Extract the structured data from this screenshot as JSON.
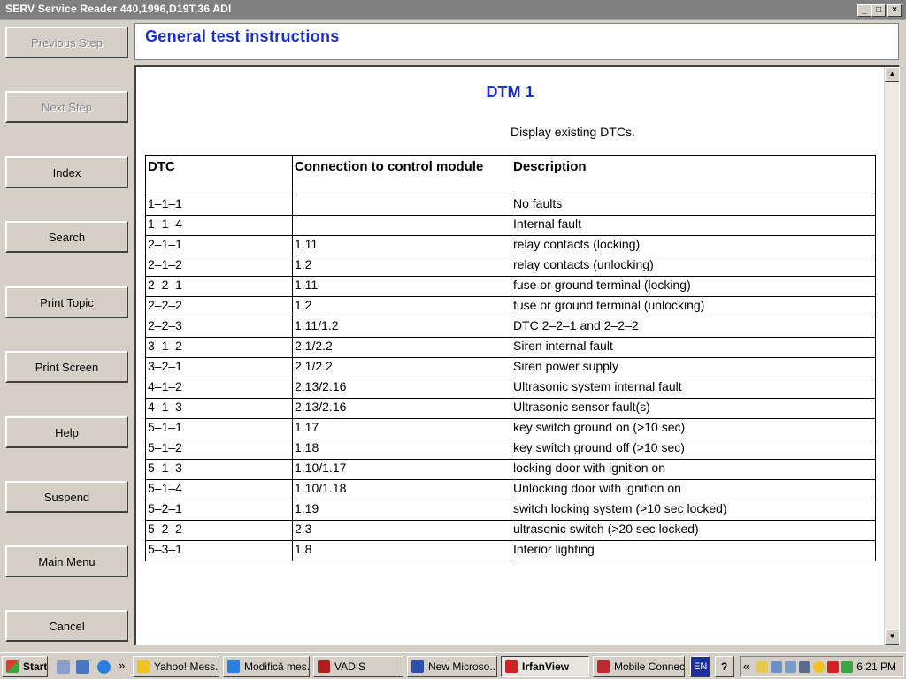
{
  "window": {
    "title": "SERV Service Reader 440,1996,D19T,36 ADI",
    "min_glyph": "_",
    "max_glyph": "□",
    "close_glyph": "×"
  },
  "nav": {
    "previous": "Previous Step",
    "next": "Next Step",
    "index": "Index",
    "search": "Search",
    "print_topic": "Print Topic",
    "print_screen": "Print Screen",
    "help": "Help",
    "suspend": "Suspend",
    "main_menu": "Main Menu",
    "cancel": "Cancel"
  },
  "header": {
    "title": "General test instructions"
  },
  "document": {
    "title": "DTM 1",
    "subtitle": "Display existing DTCs.",
    "columns": [
      "DTC",
      "Connection to control module",
      "Description"
    ],
    "rows": [
      [
        "1–1–1",
        "",
        "No faults"
      ],
      [
        "1–1–4",
        "",
        "Internal fault"
      ],
      [
        "2–1–1",
        "1.11",
        "relay contacts (locking)"
      ],
      [
        "2–1–2",
        "1.2",
        "relay contacts (unlocking)"
      ],
      [
        "2–2–1",
        "1.11",
        "fuse or ground terminal (locking)"
      ],
      [
        "2–2–2",
        "1.2",
        "fuse or ground terminal (unlocking)"
      ],
      [
        "2–2–3",
        "1.11/1.2",
        "DTC 2–2–1 and 2–2–2"
      ],
      [
        "3–1–2",
        "2.1/2.2",
        "Siren internal fault"
      ],
      [
        "3–2–1",
        "2.1/2.2",
        "Siren power supply"
      ],
      [
        "4–1–2",
        "2.13/2.16",
        "Ultrasonic system internal fault"
      ],
      [
        "4–1–3",
        "2.13/2.16",
        "Ultrasonic sensor fault(s)"
      ],
      [
        "5–1–1",
        "1.17",
        "key switch ground on (>10 sec)"
      ],
      [
        "5–1–2",
        "1.18",
        "key switch ground off (>10 sec)"
      ],
      [
        "5–1–3",
        "1.10/1.17",
        "locking door with ignition on"
      ],
      [
        "5–1–4",
        "1.10/1.18",
        "Unlocking door with ignition on"
      ],
      [
        "5–2–1",
        "1.19",
        "switch locking system (>10 sec locked)"
      ],
      [
        "5–2–2",
        "2.3",
        "ultrasonic switch (>20 sec locked)"
      ],
      [
        "5–3–1",
        "1.8",
        "Interior lighting"
      ]
    ]
  },
  "taskbar": {
    "start": "Start",
    "chevron": "»",
    "buttons": [
      {
        "label": "Yahoo! Mess...",
        "icon": "yahoo-messenger-icon",
        "color": "#f2c21b"
      },
      {
        "label": "Modifică mes...",
        "icon": "internet-explorer-icon",
        "color": "#2a7de1"
      },
      {
        "label": "VADIS",
        "icon": "vadis-icon",
        "color": "#b01f1f"
      },
      {
        "label": "New Microso...",
        "icon": "word-document-icon",
        "color": "#2b4fb3"
      },
      {
        "label": "IrfanView",
        "icon": "irfanview-icon",
        "color": "#d42020",
        "active": true
      },
      {
        "label": "Mobile Connect",
        "icon": "mobile-connect-icon",
        "color": "#c0282d"
      }
    ],
    "lang": "EN",
    "help_glyph": "?",
    "tray_chevron": "«",
    "clock": "6:21 PM"
  }
}
